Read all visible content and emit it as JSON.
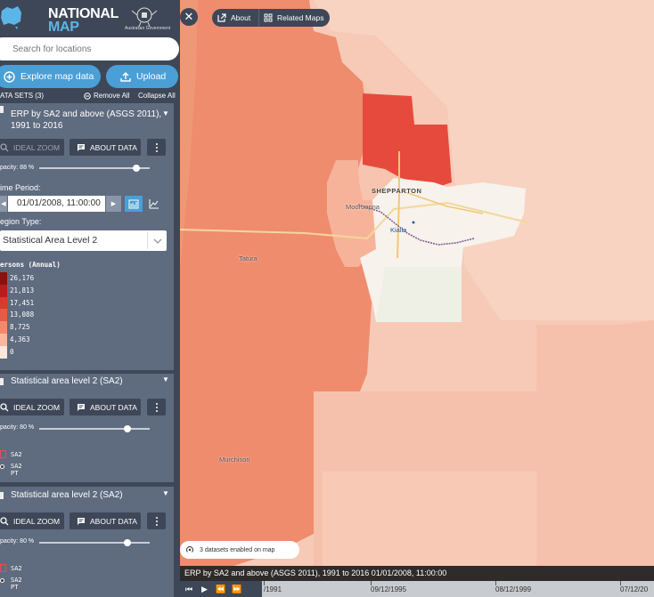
{
  "brand": {
    "line1": "NATIONAL",
    "line2": "MAP",
    "gov_text": "Australian Government"
  },
  "search": {
    "placeholder": "Search for locations"
  },
  "actions": {
    "explore": "Explore map data",
    "upload": "Upload"
  },
  "datasets_header": {
    "title": "ATA SETS (3)",
    "remove_all": "Remove All",
    "collapse_all": "Collapse All"
  },
  "panels": [
    {
      "title_line1": "ERP by SA2 and above (ASGS 2011),",
      "title_line2": "1991 to 2016",
      "ideal_zoom": "IDEAL ZOOM",
      "about_data": "ABOUT DATA",
      "opacity": "pacity: 88 %",
      "opacity_value": 0.88,
      "time_label": "ime Period:",
      "date": "01/01/2008, 11:00:00",
      "region_label": "egion Type:",
      "region_value": "Statistical Area Level 2",
      "legend_title": "ersons (Annual)",
      "legend": [
        {
          "value": "26,176",
          "color": "#8e0f0f"
        },
        {
          "value": "21,813",
          "color": "#b81d1d"
        },
        {
          "value": "17,451",
          "color": "#d83a2c"
        },
        {
          "value": "13,088",
          "color": "#ea5a43"
        },
        {
          "value": "8,725",
          "color": "#f4886b"
        },
        {
          "value": "4,363",
          "color": "#f9b79f"
        },
        {
          "value": "0",
          "color": "#fde6da"
        }
      ]
    },
    {
      "title": "Statistical area level 2 (SA2)",
      "ideal_zoom": "IDEAL ZOOM",
      "about_data": "ABOUT DATA",
      "opacity": "pacity: 80 %",
      "opacity_value": 0.8,
      "legend_a": "SA2",
      "legend_b": "SA2 PT"
    },
    {
      "title": "Statistical area level 2 (SA2)",
      "ideal_zoom": "IDEAL ZOOM",
      "about_data": "ABOUT DATA",
      "opacity": "pacity: 80 %",
      "opacity_value": 0.8,
      "legend_a": "SA2",
      "legend_b": "SA2 PT"
    }
  ],
  "map": {
    "about": "About",
    "related_maps": "Related Maps",
    "places": {
      "shepparton": "SHEPPARTON",
      "mooroopna": "Mooroopna",
      "kialla": "Kialla",
      "tatura": "Tatura",
      "murchison": "Murchison"
    },
    "datasets_chip": "3 datasets enabled on map",
    "caption": "ERP by SA2 and above (ASGS 2011), 1991 to 2016 01/01/2008, 11:00:00"
  },
  "timeline": {
    "ticks": [
      "/1991",
      "09/12/1995",
      "08/12/1999",
      "07/12/20"
    ]
  }
}
